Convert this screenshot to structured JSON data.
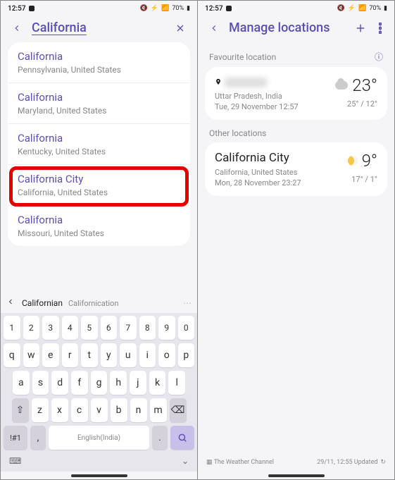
{
  "left": {
    "status": {
      "time": "12:57",
      "battery": "70%",
      "signal": "📶"
    },
    "header": {
      "search_text": "California"
    },
    "results": [
      {
        "name": "California",
        "sub": "Pennsylvania, United States"
      },
      {
        "name": "California",
        "sub": "Maryland, United States"
      },
      {
        "name": "California",
        "sub": "Kentucky, United States"
      },
      {
        "name": "California City",
        "sub": "California, United States",
        "highlighted": true
      },
      {
        "name": "California",
        "sub": "Missouri, United States"
      }
    ],
    "suggestions": {
      "w1": "Californian",
      "w2": "Californication"
    },
    "keyboard": {
      "row_num": [
        "1",
        "2",
        "3",
        "4",
        "5",
        "6",
        "7",
        "8",
        "9",
        "0"
      ],
      "row_q": [
        "q",
        "w",
        "e",
        "r",
        "t",
        "y",
        "u",
        "i",
        "o",
        "p"
      ],
      "row_a": [
        "a",
        "s",
        "d",
        "f",
        "g",
        "h",
        "j",
        "k",
        "l"
      ],
      "row_z": [
        "z",
        "x",
        "c",
        "v",
        "b",
        "n",
        "m"
      ],
      "sym": "!#1",
      "comma": ",",
      "space": "English(India)",
      "dot": "."
    }
  },
  "right": {
    "status": {
      "time": "12:57",
      "battery": "70%"
    },
    "header": {
      "title": "Manage locations"
    },
    "fav_label": "Favourite location",
    "fav": {
      "loc_hidden": "██████",
      "sub1": "Uttar Pradesh, India",
      "sub2": "Tue, 29 November 12:57",
      "temp": "23°",
      "hl": "25° / 12°"
    },
    "other_label": "Other locations",
    "other": {
      "loc": "California City",
      "sub1": "California, United States",
      "sub2": "Mon, 28 November 23:27",
      "temp": "9°",
      "hl": "17° / 1°"
    },
    "footer": {
      "brand": "The Weather Channel",
      "updated": "29/11, 12:55 Updated"
    }
  }
}
